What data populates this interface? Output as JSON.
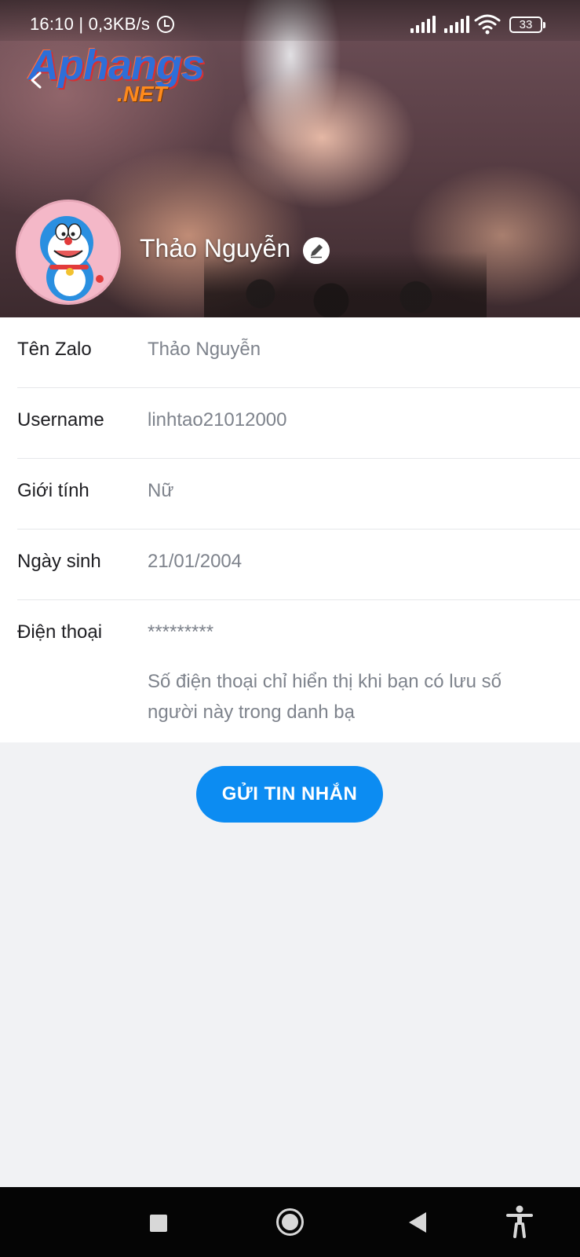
{
  "status_bar": {
    "time_speed": "16:10 | 0,3KB/s",
    "battery": "33"
  },
  "watermark": {
    "main": "Aphangs",
    "sub": ".NET"
  },
  "profile": {
    "name": "Thảo Nguyễn"
  },
  "info_rows": [
    {
      "label": "Tên Zalo",
      "value": "Thảo Nguyễn"
    },
    {
      "label": "Username",
      "value": "linhtao21012000"
    },
    {
      "label": "Giới tính",
      "value": "Nữ"
    },
    {
      "label": "Ngày sinh",
      "value": "21/01/2004"
    },
    {
      "label": "Điện thoại",
      "value": "*********",
      "note": "Số điện thoại chỉ hiển thị khi bạn có lưu số người này trong danh bạ"
    }
  ],
  "actions": {
    "send_message": "GỬI TIN NHẮN"
  },
  "icons": {
    "alarm": "alarm-icon",
    "signal": "signal-icon",
    "wifi": "wifi-icon",
    "battery": "battery-icon",
    "back": "back-icon",
    "edit": "edit-icon",
    "nav_recent": "square-icon",
    "nav_home": "circle-icon",
    "nav_back": "triangle-icon",
    "nav_accessibility": "accessibility-icon"
  },
  "colors": {
    "accent": "#0c8cf2",
    "background": "#f1f2f4",
    "label": "#1e1e22",
    "value": "#7e838c"
  }
}
